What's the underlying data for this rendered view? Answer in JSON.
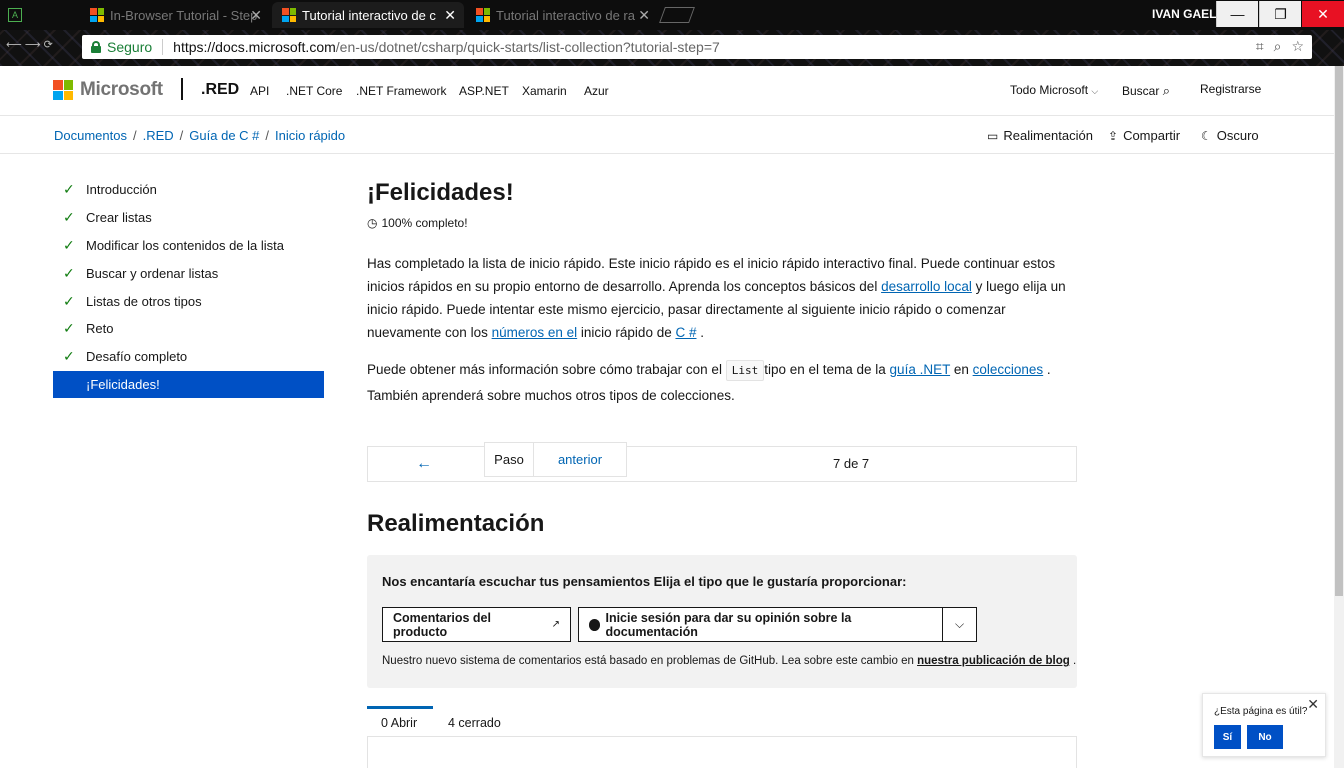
{
  "browser": {
    "tabs": [
      {
        "title": "In-Browser Tutorial - Step",
        "active": false
      },
      {
        "title": "Tutorial interactivo de c",
        "active": true
      },
      {
        "title": "Tutorial interactivo de ra",
        "active": false
      }
    ],
    "user": "IVAN GAEL",
    "secure_label": "Seguro",
    "url_host": "https://docs.microsoft.com",
    "url_path": "/en-us/dotnet/csharp/quick-starts/list-collection?tutorial-step=7"
  },
  "header": {
    "brand": "Microsoft",
    "product": ".RED",
    "nav": [
      "API",
      ".NET Core",
      ".NET Framework",
      "ASP.NET",
      "Xamarin",
      "Azur"
    ],
    "all_microsoft": "Todo Microsoft",
    "search": "Buscar",
    "signin": "Registrarse"
  },
  "breadcrumb": [
    "Documentos",
    ".RED",
    "Guía de C #",
    "Inicio rápido"
  ],
  "actions": {
    "feedback": "Realimentación",
    "share": "Compartir",
    "dark": "Oscuro"
  },
  "toc": [
    {
      "label": "Introducción",
      "done": true
    },
    {
      "label": "Crear listas",
      "done": true
    },
    {
      "label": "Modificar los contenidos de la lista",
      "done": true
    },
    {
      "label": "Buscar y ordenar listas",
      "done": true
    },
    {
      "label": "Listas de otros tipos",
      "done": true
    },
    {
      "label": "Reto",
      "done": true
    },
    {
      "label": "Desafío completo",
      "done": true
    },
    {
      "label": "¡Felicidades!",
      "done": false,
      "active": true
    }
  ],
  "article": {
    "title": "¡Felicidades!",
    "progress": "100% completo!",
    "p1_a": "Has completado la lista de inicio rápido. Este inicio rápido es el inicio rápido interactivo final. Puede continuar estos inicios rápidos en su propio entorno de desarrollo. Aprenda los conceptos básicos del ",
    "p1_link1": "desarrollo local",
    "p1_b": " y luego elija un inicio rápido. Puede intentar este mismo ejercicio, pasar directamente al siguiente inicio rápido o comenzar nuevamente con los ",
    "p1_link2": "números en el",
    "p1_c": " inicio rápido de ",
    "p1_link3": "C #",
    "p1_d": " .",
    "p2_a": "Puede obtener más información sobre cómo trabajar con el ",
    "p2_code": "List",
    "p2_b": "tipo en el tema de la ",
    "p2_link1": "guía .NET",
    "p2_c": " en ",
    "p2_link2": "colecciones",
    "p2_d": " . También aprenderá sobre muchos otros tipos de colecciones."
  },
  "pager": {
    "arrow": "←",
    "step": "Paso",
    "prev": "anterior",
    "count": "7 de 7"
  },
  "feedback": {
    "heading": "Realimentación",
    "prompt": "Nos encantaría escuchar tus pensamientos Elija el tipo que le gustaría proporcionar:",
    "product_btn": "Comentarios del producto",
    "docs_btn": "Inicie sesión para dar su opinión sobre la documentación",
    "note_a": "Nuestro nuevo sistema de comentarios está basado en problemas de GitHub. Lea sobre este cambio en ",
    "note_link": "nuestra publicación de blog",
    "note_b": " ."
  },
  "issues": {
    "open": "0 Abrir",
    "closed": "4 cerrado"
  },
  "rating": {
    "question": "¿Esta página es útil?",
    "yes": "Sí",
    "no": "No"
  },
  "colors": {
    "accent": "#0050c5",
    "link": "#0065b3",
    "check": "#107c10",
    "ms_red": "#f25022",
    "ms_green": "#7fba00",
    "ms_blue": "#00a4ef",
    "ms_yellow": "#ffb900"
  }
}
